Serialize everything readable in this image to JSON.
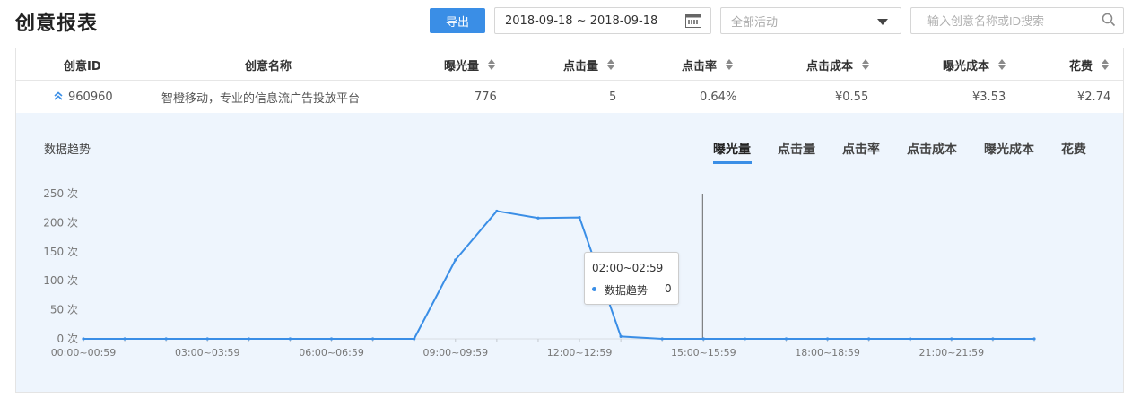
{
  "header": {
    "title": "创意报表",
    "export_label": "导出",
    "date_range": "2018-09-18 ~ 2018-09-18",
    "activity_placeholder": "全部活动",
    "search_placeholder": "输入创意名称或ID搜索"
  },
  "table": {
    "columns": [
      "创意ID",
      "创意名称",
      "曝光量",
      "点击量",
      "点击率",
      "点击成本",
      "曝光成本",
      "花费"
    ],
    "row": {
      "id": "960960",
      "name": "智橙移动，专业的信息流广告投放平台",
      "impressions": "776",
      "clicks": "5",
      "ctr": "0.64%",
      "cpc": "¥0.55",
      "cpm": "¥3.53",
      "spend": "¥2.74"
    }
  },
  "trend": {
    "title": "数据趋势",
    "tabs": [
      "曝光量",
      "点击量",
      "点击率",
      "点击成本",
      "曝光成本",
      "花费"
    ],
    "active_tab": "曝光量",
    "tooltip": {
      "time": "02:00~02:59",
      "series": "数据趋势",
      "value": "0"
    }
  },
  "colors": {
    "accent": "#3a8ee6",
    "line": "#3a8ee6"
  },
  "chart_data": {
    "type": "line",
    "x": [
      "00:00~00:59",
      "01:00~01:59",
      "02:00~02:59",
      "03:00~03:59",
      "04:00~04:59",
      "05:00~05:59",
      "06:00~06:59",
      "07:00~07:59",
      "08:00~08:59",
      "09:00~09:59",
      "10:00~10:59",
      "11:00~11:59",
      "12:00~12:59",
      "13:00~13:59",
      "14:00~14:59",
      "15:00~15:59",
      "16:00~16:59",
      "17:00~17:59",
      "18:00~18:59",
      "19:00~19:59",
      "20:00~20:59",
      "21:00~21:59",
      "22:00~22:59",
      "23:00~23:59"
    ],
    "series": [
      {
        "name": "数据趋势",
        "values": [
          0,
          0,
          0,
          0,
          0,
          0,
          0,
          0,
          0,
          136,
          220,
          208,
          209,
          4,
          0,
          0,
          0,
          0,
          0,
          0,
          0,
          0,
          0,
          0
        ]
      }
    ],
    "y_ticks": [
      "0 次",
      "50 次",
      "100 次",
      "150 次",
      "200 次",
      "250 次"
    ],
    "x_tick_labels": [
      "00:00~00:59",
      "03:00~03:59",
      "06:00~06:59",
      "09:00~09:59",
      "12:00~12:59",
      "15:00~15:59",
      "18:00~18:59",
      "21:00~21:59"
    ],
    "ylim": [
      0,
      250
    ],
    "grid": false,
    "legend": "none"
  }
}
